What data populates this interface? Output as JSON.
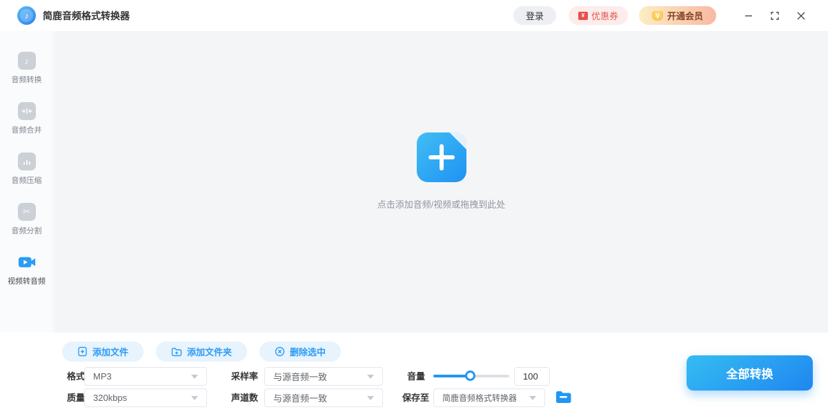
{
  "titlebar": {
    "app_title": "简鹿音频格式转换器",
    "login_label": "登录",
    "coupon_label": "优惠券",
    "vip_label": "开通会员"
  },
  "sidebar": {
    "items": [
      {
        "label": "音频转换",
        "icon": "music-note-icon",
        "active": false
      },
      {
        "label": "音频合并",
        "icon": "merge-icon",
        "active": false
      },
      {
        "label": "音频压缩",
        "icon": "compress-icon",
        "active": false
      },
      {
        "label": "音频分割",
        "icon": "scissors-icon",
        "active": false
      },
      {
        "label": "视频转音频",
        "icon": "video-camera-icon",
        "active": true
      }
    ]
  },
  "dropzone": {
    "hint": "点击添加音频/视频或拖拽到此处"
  },
  "toolbar": {
    "add_file_label": "添加文件",
    "add_folder_label": "添加文件夹",
    "delete_selected_label": "删除选中"
  },
  "settings": {
    "format_label": "格式",
    "format_value": "MP3",
    "sample_rate_label": "采样率",
    "sample_rate_value": "与源音频一致",
    "volume_label": "音量",
    "volume_value": "100",
    "quality_label": "质量",
    "quality_value": "320kbps",
    "channels_label": "声道数",
    "channels_value": "与源音频一致",
    "save_to_label": "保存至",
    "save_to_value": "简鹿音频格式转换器"
  },
  "convert_button_label": "全部转换",
  "colors": {
    "accent": "#2196f3",
    "pill_bg": "#e7f3fd",
    "coupon_red": "#e25a51",
    "vip_text": "#84432a",
    "dropzone_bg": "#f4f5f7",
    "convert_gradient_start": "#35bdf3",
    "convert_gradient_end": "#1f86f0"
  }
}
